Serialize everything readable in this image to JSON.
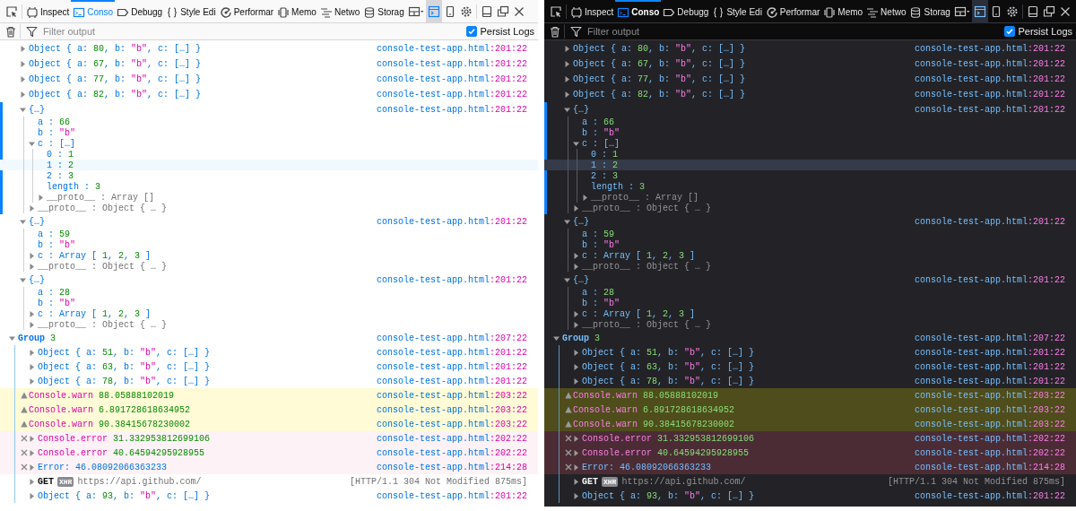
{
  "panels": [
    {
      "kind": "light",
      "tabs": [
        {
          "label": "Inspect",
          "selected": false
        },
        {
          "label": "Conso",
          "selected": true
        },
        {
          "label": "Debugg",
          "selected": false
        },
        {
          "label": "Style Edi",
          "selected": false
        },
        {
          "label": "Performar",
          "selected": false
        },
        {
          "label": "Memo",
          "selected": false
        },
        {
          "label": "Netwo",
          "selected": false
        },
        {
          "label": "Storag",
          "selected": false
        }
      ],
      "split_console": {
        "on": true
      },
      "filter": {
        "placeholder": "Filter output"
      },
      "persist_logs": {
        "label": "Persist Logs",
        "checked": true
      },
      "log": [
        {
          "kind": "node",
          "expanded": false,
          "selected": false,
          "parts": [
            {
              "text": "Object { a: ",
              "kind": "key"
            },
            {
              "text": "80",
              "kind": "number"
            },
            {
              "text": ", b: ",
              "kind": "key"
            },
            {
              "text": "\"b\"",
              "kind": "string"
            },
            {
              "text": ", c: […] }",
              "kind": "key"
            }
          ],
          "file": "console-test-app.html",
          "pos": ":201:22"
        },
        {
          "kind": "node",
          "expanded": false,
          "selected": false,
          "parts": [
            {
              "text": "Object { a: ",
              "kind": "key"
            },
            {
              "text": "67",
              "kind": "number"
            },
            {
              "text": ", b: ",
              "kind": "key"
            },
            {
              "text": "\"b\"",
              "kind": "string"
            },
            {
              "text": ", c: […] }",
              "kind": "key"
            }
          ],
          "file": "console-test-app.html",
          "pos": ":201:22"
        },
        {
          "kind": "node",
          "expanded": false,
          "selected": false,
          "parts": [
            {
              "text": "Object { a: ",
              "kind": "key"
            },
            {
              "text": "77",
              "kind": "number"
            },
            {
              "text": ", b: ",
              "kind": "key"
            },
            {
              "text": "\"b\"",
              "kind": "string"
            },
            {
              "text": ", c: […] }",
              "kind": "key"
            }
          ],
          "file": "console-test-app.html",
          "pos": ":201:22"
        },
        {
          "kind": "node",
          "expanded": false,
          "selected": false,
          "parts": [
            {
              "text": "Object { a: ",
              "kind": "key"
            },
            {
              "text": "82",
              "kind": "number"
            },
            {
              "text": ", b: ",
              "kind": "key"
            },
            {
              "text": "\"b\"",
              "kind": "string"
            },
            {
              "text": ", c: […] }",
              "kind": "key"
            }
          ],
          "file": "console-test-app.html",
          "pos": ":201:22"
        },
        {
          "kind": "node",
          "expanded": true,
          "selected": true,
          "parts": [
            {
              "text": "{…}",
              "kind": "key"
            }
          ],
          "file": "console-test-app.html",
          "pos": ":201:22",
          "children": [
            {
              "kind": "leaf",
              "parts": [
                {
                  "text": "a : ",
                  "kind": "key"
                },
                {
                  "text": "66",
                  "kind": "number"
                }
              ]
            },
            {
              "kind": "leaf",
              "parts": [
                {
                  "text": "b : ",
                  "kind": "key"
                },
                {
                  "text": "\"b\"",
                  "kind": "string"
                }
              ]
            },
            {
              "kind": "node",
              "expanded": true,
              "parts": [
                {
                  "text": "c : […]",
                  "kind": "key"
                }
              ],
              "children": [
                {
                  "kind": "leaf",
                  "highlighted": false,
                  "parts": [
                    {
                      "text": "0 : ",
                      "kind": "key"
                    },
                    {
                      "text": "1",
                      "kind": "number"
                    }
                  ]
                },
                {
                  "kind": "leaf",
                  "highlighted": true,
                  "parts": [
                    {
                      "text": "1 : ",
                      "kind": "key"
                    },
                    {
                      "text": "2",
                      "kind": "number"
                    }
                  ]
                },
                {
                  "kind": "leaf",
                  "highlighted": false,
                  "parts": [
                    {
                      "text": "2 : ",
                      "kind": "key"
                    },
                    {
                      "text": "3",
                      "kind": "number"
                    }
                  ]
                },
                {
                  "kind": "leaf",
                  "highlighted": false,
                  "parts": [
                    {
                      "text": "length : ",
                      "kind": "key"
                    },
                    {
                      "text": "3",
                      "kind": "number"
                    }
                  ]
                },
                {
                  "kind": "node",
                  "expanded": false,
                  "highlighted": false,
                  "parts": [
                    {
                      "text": "__proto__ : Array []",
                      "kind": "muted"
                    }
                  ]
                }
              ]
            },
            {
              "kind": "node",
              "expanded": false,
              "parts": [
                {
                  "text": "__proto__ : Object { … }",
                  "kind": "muted"
                }
              ]
            }
          ]
        },
        {
          "kind": "node",
          "expanded": true,
          "selected": false,
          "parts": [
            {
              "text": "{…}",
              "kind": "key"
            }
          ],
          "file": "console-test-app.html",
          "pos": ":201:22",
          "children": [
            {
              "kind": "leaf",
              "parts": [
                {
                  "text": "a : ",
                  "kind": "key"
                },
                {
                  "text": "59",
                  "kind": "number"
                }
              ]
            },
            {
              "kind": "leaf",
              "parts": [
                {
                  "text": "b : ",
                  "kind": "key"
                },
                {
                  "text": "\"b\"",
                  "kind": "string"
                }
              ]
            },
            {
              "kind": "node",
              "expanded": false,
              "parts": [
                {
                  "text": "c : Array [ ",
                  "kind": "key"
                },
                {
                  "text": "1",
                  "kind": "number"
                },
                {
                  "text": ", ",
                  "kind": "key"
                },
                {
                  "text": "2",
                  "kind": "number"
                },
                {
                  "text": ", ",
                  "kind": "key"
                },
                {
                  "text": "3",
                  "kind": "number"
                },
                {
                  "text": " ]",
                  "kind": "key"
                }
              ]
            },
            {
              "kind": "node",
              "expanded": false,
              "parts": [
                {
                  "text": "__proto__ : Object { … }",
                  "kind": "muted"
                }
              ]
            }
          ]
        },
        {
          "kind": "node",
          "expanded": true,
          "selected": false,
          "parts": [
            {
              "text": "{…}",
              "kind": "key"
            }
          ],
          "file": "console-test-app.html",
          "pos": ":201:22",
          "children": [
            {
              "kind": "leaf",
              "parts": [
                {
                  "text": "a : ",
                  "kind": "key"
                },
                {
                  "text": "28",
                  "kind": "number"
                }
              ]
            },
            {
              "kind": "leaf",
              "parts": [
                {
                  "text": "b : ",
                  "kind": "key"
                },
                {
                  "text": "\"b\"",
                  "kind": "string"
                }
              ]
            },
            {
              "kind": "node",
              "expanded": false,
              "parts": [
                {
                  "text": "c : Array [ ",
                  "kind": "key"
                },
                {
                  "text": "1",
                  "kind": "number"
                },
                {
                  "text": ", ",
                  "kind": "key"
                },
                {
                  "text": "2",
                  "kind": "number"
                },
                {
                  "text": ", ",
                  "kind": "key"
                },
                {
                  "text": "3",
                  "kind": "number"
                },
                {
                  "text": " ]",
                  "kind": "key"
                }
              ]
            },
            {
              "kind": "node",
              "expanded": false,
              "parts": [
                {
                  "text": "__proto__ : Object { … }",
                  "kind": "muted"
                }
              ]
            }
          ]
        },
        {
          "kind": "group",
          "expanded": true,
          "selected": false,
          "parts": [
            {
              "text": "Group ",
              "kind": "label"
            },
            {
              "text": "3",
              "kind": "number"
            }
          ],
          "file": "console-test-app.html",
          "pos": ":207:22",
          "children": [
            {
              "kind": "node",
              "expanded": false,
              "parts": [
                {
                  "text": "Object { a: ",
                  "kind": "key"
                },
                {
                  "text": "51",
                  "kind": "number"
                },
                {
                  "text": ", b: ",
                  "kind": "key"
                },
                {
                  "text": "\"b\"",
                  "kind": "string"
                },
                {
                  "text": ", c: […] }",
                  "kind": "key"
                }
              ],
              "file": "console-test-app.html",
              "pos": ":201:22"
            },
            {
              "kind": "node",
              "expanded": false,
              "parts": [
                {
                  "text": "Object { a: ",
                  "kind": "key"
                },
                {
                  "text": "63",
                  "kind": "number"
                },
                {
                  "text": ", b: ",
                  "kind": "key"
                },
                {
                  "text": "\"b\"",
                  "kind": "string"
                },
                {
                  "text": ", c: […] }",
                  "kind": "key"
                }
              ],
              "file": "console-test-app.html",
              "pos": ":201:22"
            },
            {
              "kind": "node",
              "expanded": false,
              "parts": [
                {
                  "text": "Object { a: ",
                  "kind": "key"
                },
                {
                  "text": "78",
                  "kind": "number"
                },
                {
                  "text": ", b: ",
                  "kind": "key"
                },
                {
                  "text": "\"b\"",
                  "kind": "string"
                },
                {
                  "text": ", c: […] }",
                  "kind": "key"
                }
              ],
              "file": "console-test-app.html",
              "pos": ":201:22"
            },
            {
              "kind": "warn",
              "parts": [
                {
                  "text": "Console.warn ",
                  "kind": "string"
                },
                {
                  "text": "88.05888102019",
                  "kind": "number"
                }
              ],
              "file": "console-test-app.html",
              "pos": ":203:22"
            },
            {
              "kind": "warn",
              "parts": [
                {
                  "text": "Console.warn ",
                  "kind": "string"
                },
                {
                  "text": "6.891728618634952",
                  "kind": "number"
                }
              ],
              "file": "console-test-app.html",
              "pos": ":203:22"
            },
            {
              "kind": "warn",
              "parts": [
                {
                  "text": "Console.warn ",
                  "kind": "string"
                },
                {
                  "text": "90.38415678230002",
                  "kind": "number"
                }
              ],
              "file": "console-test-app.html",
              "pos": ":203:22"
            },
            {
              "kind": "error",
              "expanded": false,
              "parts": [
                {
                  "text": "Console.error ",
                  "kind": "string"
                },
                {
                  "text": "31.332953812699106",
                  "kind": "number"
                }
              ],
              "file": "console-test-app.html",
              "pos": ":202:22"
            },
            {
              "kind": "error",
              "expanded": false,
              "parts": [
                {
                  "text": "Console.error ",
                  "kind": "string"
                },
                {
                  "text": "40.64594295928955",
                  "kind": "number"
                }
              ],
              "file": "console-test-app.html",
              "pos": ":202:22"
            },
            {
              "kind": "error",
              "expanded": false,
              "parts": [
                {
                  "text": "Error: 46.08092066363233",
                  "kind": "plain"
                }
              ],
              "file": "console-test-app.html",
              "pos": ":214:28"
            },
            {
              "kind": "network",
              "expanded": false,
              "parts": [
                {
                  "text": "GET",
                  "kind": "method"
                },
                {
                  "text": "XHR",
                  "kind": "badge"
                },
                {
                  "text": "https://api.github.com/",
                  "kind": "muted"
                }
              ],
              "status": "[HTTP/1.1 304 Not Modified 875ms]"
            },
            {
              "kind": "node",
              "expanded": false,
              "parts": [
                {
                  "text": "Object { a: ",
                  "kind": "key"
                },
                {
                  "text": "93",
                  "kind": "number"
                },
                {
                  "text": ", b: ",
                  "kind": "key"
                },
                {
                  "text": "\"b\"",
                  "kind": "string"
                },
                {
                  "text": ", c: […] }",
                  "kind": "key"
                }
              ],
              "file": "console-test-app.html",
              "pos": ":201:22"
            }
          ]
        }
      ]
    },
    {
      "kind": "dark",
      "tabs": [
        {
          "label": "Inspect",
          "selected": false
        },
        {
          "label": "Conso",
          "selected": true
        },
        {
          "label": "Debugg",
          "selected": false
        },
        {
          "label": "Style Edi",
          "selected": false
        },
        {
          "label": "Performar",
          "selected": false
        },
        {
          "label": "Memo",
          "selected": false
        },
        {
          "label": "Netwo",
          "selected": false
        },
        {
          "label": "Storag",
          "selected": false
        }
      ],
      "split_console": {
        "on": true
      },
      "filter": {
        "placeholder": "Filter output"
      },
      "persist_logs": {
        "label": "Persist Logs",
        "checked": true
      },
      "log": [
        {
          "kind": "node",
          "expanded": false,
          "selected": false,
          "parts": [
            {
              "text": "Object { a: ",
              "kind": "key"
            },
            {
              "text": "80",
              "kind": "number"
            },
            {
              "text": ", b: ",
              "kind": "key"
            },
            {
              "text": "\"b\"",
              "kind": "string"
            },
            {
              "text": ", c: […] }",
              "kind": "key"
            }
          ],
          "file": "console-test-app.html",
          "pos": ":201:22"
        },
        {
          "kind": "node",
          "expanded": false,
          "selected": false,
          "parts": [
            {
              "text": "Object { a: ",
              "kind": "key"
            },
            {
              "text": "67",
              "kind": "number"
            },
            {
              "text": ", b: ",
              "kind": "key"
            },
            {
              "text": "\"b\"",
              "kind": "string"
            },
            {
              "text": ", c: […] }",
              "kind": "key"
            }
          ],
          "file": "console-test-app.html",
          "pos": ":201:22"
        },
        {
          "kind": "node",
          "expanded": false,
          "selected": false,
          "parts": [
            {
              "text": "Object { a: ",
              "kind": "key"
            },
            {
              "text": "77",
              "kind": "number"
            },
            {
              "text": ", b: ",
              "kind": "key"
            },
            {
              "text": "\"b\"",
              "kind": "string"
            },
            {
              "text": ", c: […] }",
              "kind": "key"
            }
          ],
          "file": "console-test-app.html",
          "pos": ":201:22"
        },
        {
          "kind": "node",
          "expanded": false,
          "selected": false,
          "parts": [
            {
              "text": "Object { a: ",
              "kind": "key"
            },
            {
              "text": "82",
              "kind": "number"
            },
            {
              "text": ", b: ",
              "kind": "key"
            },
            {
              "text": "\"b\"",
              "kind": "string"
            },
            {
              "text": ", c: […] }",
              "kind": "key"
            }
          ],
          "file": "console-test-app.html",
          "pos": ":201:22"
        },
        {
          "kind": "node",
          "expanded": true,
          "selected": true,
          "parts": [
            {
              "text": "{…}",
              "kind": "key"
            }
          ],
          "file": "console-test-app.html",
          "pos": ":201:22",
          "children": [
            {
              "kind": "leaf",
              "parts": [
                {
                  "text": "a : ",
                  "kind": "key"
                },
                {
                  "text": "66",
                  "kind": "number"
                }
              ]
            },
            {
              "kind": "leaf",
              "parts": [
                {
                  "text": "b : ",
                  "kind": "key"
                },
                {
                  "text": "\"b\"",
                  "kind": "string"
                }
              ]
            },
            {
              "kind": "node",
              "expanded": true,
              "parts": [
                {
                  "text": "c : […]",
                  "kind": "key"
                }
              ],
              "children": [
                {
                  "kind": "leaf",
                  "highlighted": false,
                  "parts": [
                    {
                      "text": "0 : ",
                      "kind": "key"
                    },
                    {
                      "text": "1",
                      "kind": "number"
                    }
                  ]
                },
                {
                  "kind": "leaf",
                  "highlighted": true,
                  "parts": [
                    {
                      "text": "1 : ",
                      "kind": "key"
                    },
                    {
                      "text": "2",
                      "kind": "number"
                    }
                  ]
                },
                {
                  "kind": "leaf",
                  "highlighted": false,
                  "parts": [
                    {
                      "text": "2 : ",
                      "kind": "key"
                    },
                    {
                      "text": "3",
                      "kind": "number"
                    }
                  ]
                },
                {
                  "kind": "leaf",
                  "highlighted": false,
                  "parts": [
                    {
                      "text": "length : ",
                      "kind": "key"
                    },
                    {
                      "text": "3",
                      "kind": "number"
                    }
                  ]
                },
                {
                  "kind": "node",
                  "expanded": false,
                  "highlighted": false,
                  "parts": [
                    {
                      "text": "__proto__ : Array []",
                      "kind": "muted"
                    }
                  ]
                }
              ]
            },
            {
              "kind": "node",
              "expanded": false,
              "parts": [
                {
                  "text": "__proto__ : Object { … }",
                  "kind": "muted"
                }
              ]
            }
          ]
        },
        {
          "kind": "node",
          "expanded": true,
          "selected": false,
          "parts": [
            {
              "text": "{…}",
              "kind": "key"
            }
          ],
          "file": "console-test-app.html",
          "pos": ":201:22",
          "children": [
            {
              "kind": "leaf",
              "parts": [
                {
                  "text": "a : ",
                  "kind": "key"
                },
                {
                  "text": "59",
                  "kind": "number"
                }
              ]
            },
            {
              "kind": "leaf",
              "parts": [
                {
                  "text": "b : ",
                  "kind": "key"
                },
                {
                  "text": "\"b\"",
                  "kind": "string"
                }
              ]
            },
            {
              "kind": "node",
              "expanded": false,
              "parts": [
                {
                  "text": "c : Array [ ",
                  "kind": "key"
                },
                {
                  "text": "1",
                  "kind": "number"
                },
                {
                  "text": ", ",
                  "kind": "key"
                },
                {
                  "text": "2",
                  "kind": "number"
                },
                {
                  "text": ", ",
                  "kind": "key"
                },
                {
                  "text": "3",
                  "kind": "number"
                },
                {
                  "text": " ]",
                  "kind": "key"
                }
              ]
            },
            {
              "kind": "node",
              "expanded": false,
              "parts": [
                {
                  "text": "__proto__ : Object { … }",
                  "kind": "muted"
                }
              ]
            }
          ]
        },
        {
          "kind": "node",
          "expanded": true,
          "selected": false,
          "parts": [
            {
              "text": "{…}",
              "kind": "key"
            }
          ],
          "file": "console-test-app.html",
          "pos": ":201:22",
          "children": [
            {
              "kind": "leaf",
              "parts": [
                {
                  "text": "a : ",
                  "kind": "key"
                },
                {
                  "text": "28",
                  "kind": "number"
                }
              ]
            },
            {
              "kind": "leaf",
              "parts": [
                {
                  "text": "b : ",
                  "kind": "key"
                },
                {
                  "text": "\"b\"",
                  "kind": "string"
                }
              ]
            },
            {
              "kind": "node",
              "expanded": false,
              "parts": [
                {
                  "text": "c : Array [ ",
                  "kind": "key"
                },
                {
                  "text": "1",
                  "kind": "number"
                },
                {
                  "text": ", ",
                  "kind": "key"
                },
                {
                  "text": "2",
                  "kind": "number"
                },
                {
                  "text": ", ",
                  "kind": "key"
                },
                {
                  "text": "3",
                  "kind": "number"
                },
                {
                  "text": " ]",
                  "kind": "key"
                }
              ]
            },
            {
              "kind": "node",
              "expanded": false,
              "parts": [
                {
                  "text": "__proto__ : Object { … }",
                  "kind": "muted"
                }
              ]
            }
          ]
        },
        {
          "kind": "group",
          "expanded": true,
          "selected": false,
          "parts": [
            {
              "text": "Group ",
              "kind": "label"
            },
            {
              "text": "3",
              "kind": "number"
            }
          ],
          "file": "console-test-app.html",
          "pos": ":207:22",
          "children": [
            {
              "kind": "node",
              "expanded": false,
              "parts": [
                {
                  "text": "Object { a: ",
                  "kind": "key"
                },
                {
                  "text": "51",
                  "kind": "number"
                },
                {
                  "text": ", b: ",
                  "kind": "key"
                },
                {
                  "text": "\"b\"",
                  "kind": "string"
                },
                {
                  "text": ", c: […] }",
                  "kind": "key"
                }
              ],
              "file": "console-test-app.html",
              "pos": ":201:22"
            },
            {
              "kind": "node",
              "expanded": false,
              "parts": [
                {
                  "text": "Object { a: ",
                  "kind": "key"
                },
                {
                  "text": "63",
                  "kind": "number"
                },
                {
                  "text": ", b: ",
                  "kind": "key"
                },
                {
                  "text": "\"b\"",
                  "kind": "string"
                },
                {
                  "text": ", c: […] }",
                  "kind": "key"
                }
              ],
              "file": "console-test-app.html",
              "pos": ":201:22"
            },
            {
              "kind": "node",
              "expanded": false,
              "parts": [
                {
                  "text": "Object { a: ",
                  "kind": "key"
                },
                {
                  "text": "78",
                  "kind": "number"
                },
                {
                  "text": ", b: ",
                  "kind": "key"
                },
                {
                  "text": "\"b\"",
                  "kind": "string"
                },
                {
                  "text": ", c: […] }",
                  "kind": "key"
                }
              ],
              "file": "console-test-app.html",
              "pos": ":201:22"
            },
            {
              "kind": "warn",
              "parts": [
                {
                  "text": "Console.warn ",
                  "kind": "string"
                },
                {
                  "text": "88.05888102019",
                  "kind": "number"
                }
              ],
              "file": "console-test-app.html",
              "pos": ":203:22"
            },
            {
              "kind": "warn",
              "parts": [
                {
                  "text": "Console.warn ",
                  "kind": "string"
                },
                {
                  "text": "6.891728618634952",
                  "kind": "number"
                }
              ],
              "file": "console-test-app.html",
              "pos": ":203:22"
            },
            {
              "kind": "warn",
              "parts": [
                {
                  "text": "Console.warn ",
                  "kind": "string"
                },
                {
                  "text": "90.38415678230002",
                  "kind": "number"
                }
              ],
              "file": "console-test-app.html",
              "pos": ":203:22"
            },
            {
              "kind": "error",
              "expanded": false,
              "parts": [
                {
                  "text": "Console.error ",
                  "kind": "string"
                },
                {
                  "text": "31.332953812699106",
                  "kind": "number"
                }
              ],
              "file": "console-test-app.html",
              "pos": ":202:22"
            },
            {
              "kind": "error",
              "expanded": false,
              "parts": [
                {
                  "text": "Console.error ",
                  "kind": "string"
                },
                {
                  "text": "40.64594295928955",
                  "kind": "number"
                }
              ],
              "file": "console-test-app.html",
              "pos": ":202:22"
            },
            {
              "kind": "error",
              "expanded": false,
              "parts": [
                {
                  "text": "Error: 46.08092066363233",
                  "kind": "plain"
                }
              ],
              "file": "console-test-app.html",
              "pos": ":214:28"
            },
            {
              "kind": "network",
              "expanded": false,
              "parts": [
                {
                  "text": "GET",
                  "kind": "method"
                },
                {
                  "text": "XHR",
                  "kind": "badge"
                },
                {
                  "text": "https://api.github.com/",
                  "kind": "muted"
                }
              ],
              "status": "[HTTP/1.1 304 Not Modified 875ms]"
            },
            {
              "kind": "node",
              "expanded": false,
              "parts": [
                {
                  "text": "Object { a: ",
                  "kind": "key"
                },
                {
                  "text": "93",
                  "kind": "number"
                },
                {
                  "text": ", b: ",
                  "kind": "key"
                },
                {
                  "text": "\"b\"",
                  "kind": "string"
                },
                {
                  "text": ", c: […] }",
                  "kind": "key"
                }
              ],
              "file": "console-test-app.html",
              "pos": ":201:22"
            }
          ]
        }
      ]
    }
  ]
}
